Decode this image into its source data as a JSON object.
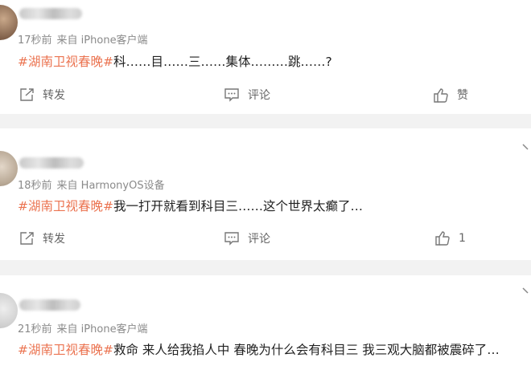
{
  "posts": [
    {
      "time": "17秒前",
      "source": "来自 iPhone客户端",
      "topic": "#湖南卫视春晚#",
      "text": "科……目……三……集体………跳……?",
      "actions": {
        "repost": "转发",
        "comment": "评论",
        "like": "赞"
      }
    },
    {
      "time": "18秒前",
      "source": "来自 HarmonyOS设备",
      "topic": "#湖南卫视春晚#",
      "text": "我一打开就看到科目三……这个世界太癫了…",
      "actions": {
        "repost": "转发",
        "comment": "评论",
        "like": "1"
      }
    },
    {
      "time": "21秒前",
      "source": "来自 iPhone客户端",
      "topic": "#湖南卫视春晚#",
      "text": "救命 来人给我掐人中 春晚为什么会有科目三 我三观大脑都被震碎了…"
    }
  ],
  "colors": {
    "topic": "#eb7350",
    "meta": "#8a8a8a",
    "background": "#f2f2f2"
  },
  "icons": [
    "repost-icon",
    "comment-icon",
    "like-icon",
    "chevron-down-icon"
  ]
}
